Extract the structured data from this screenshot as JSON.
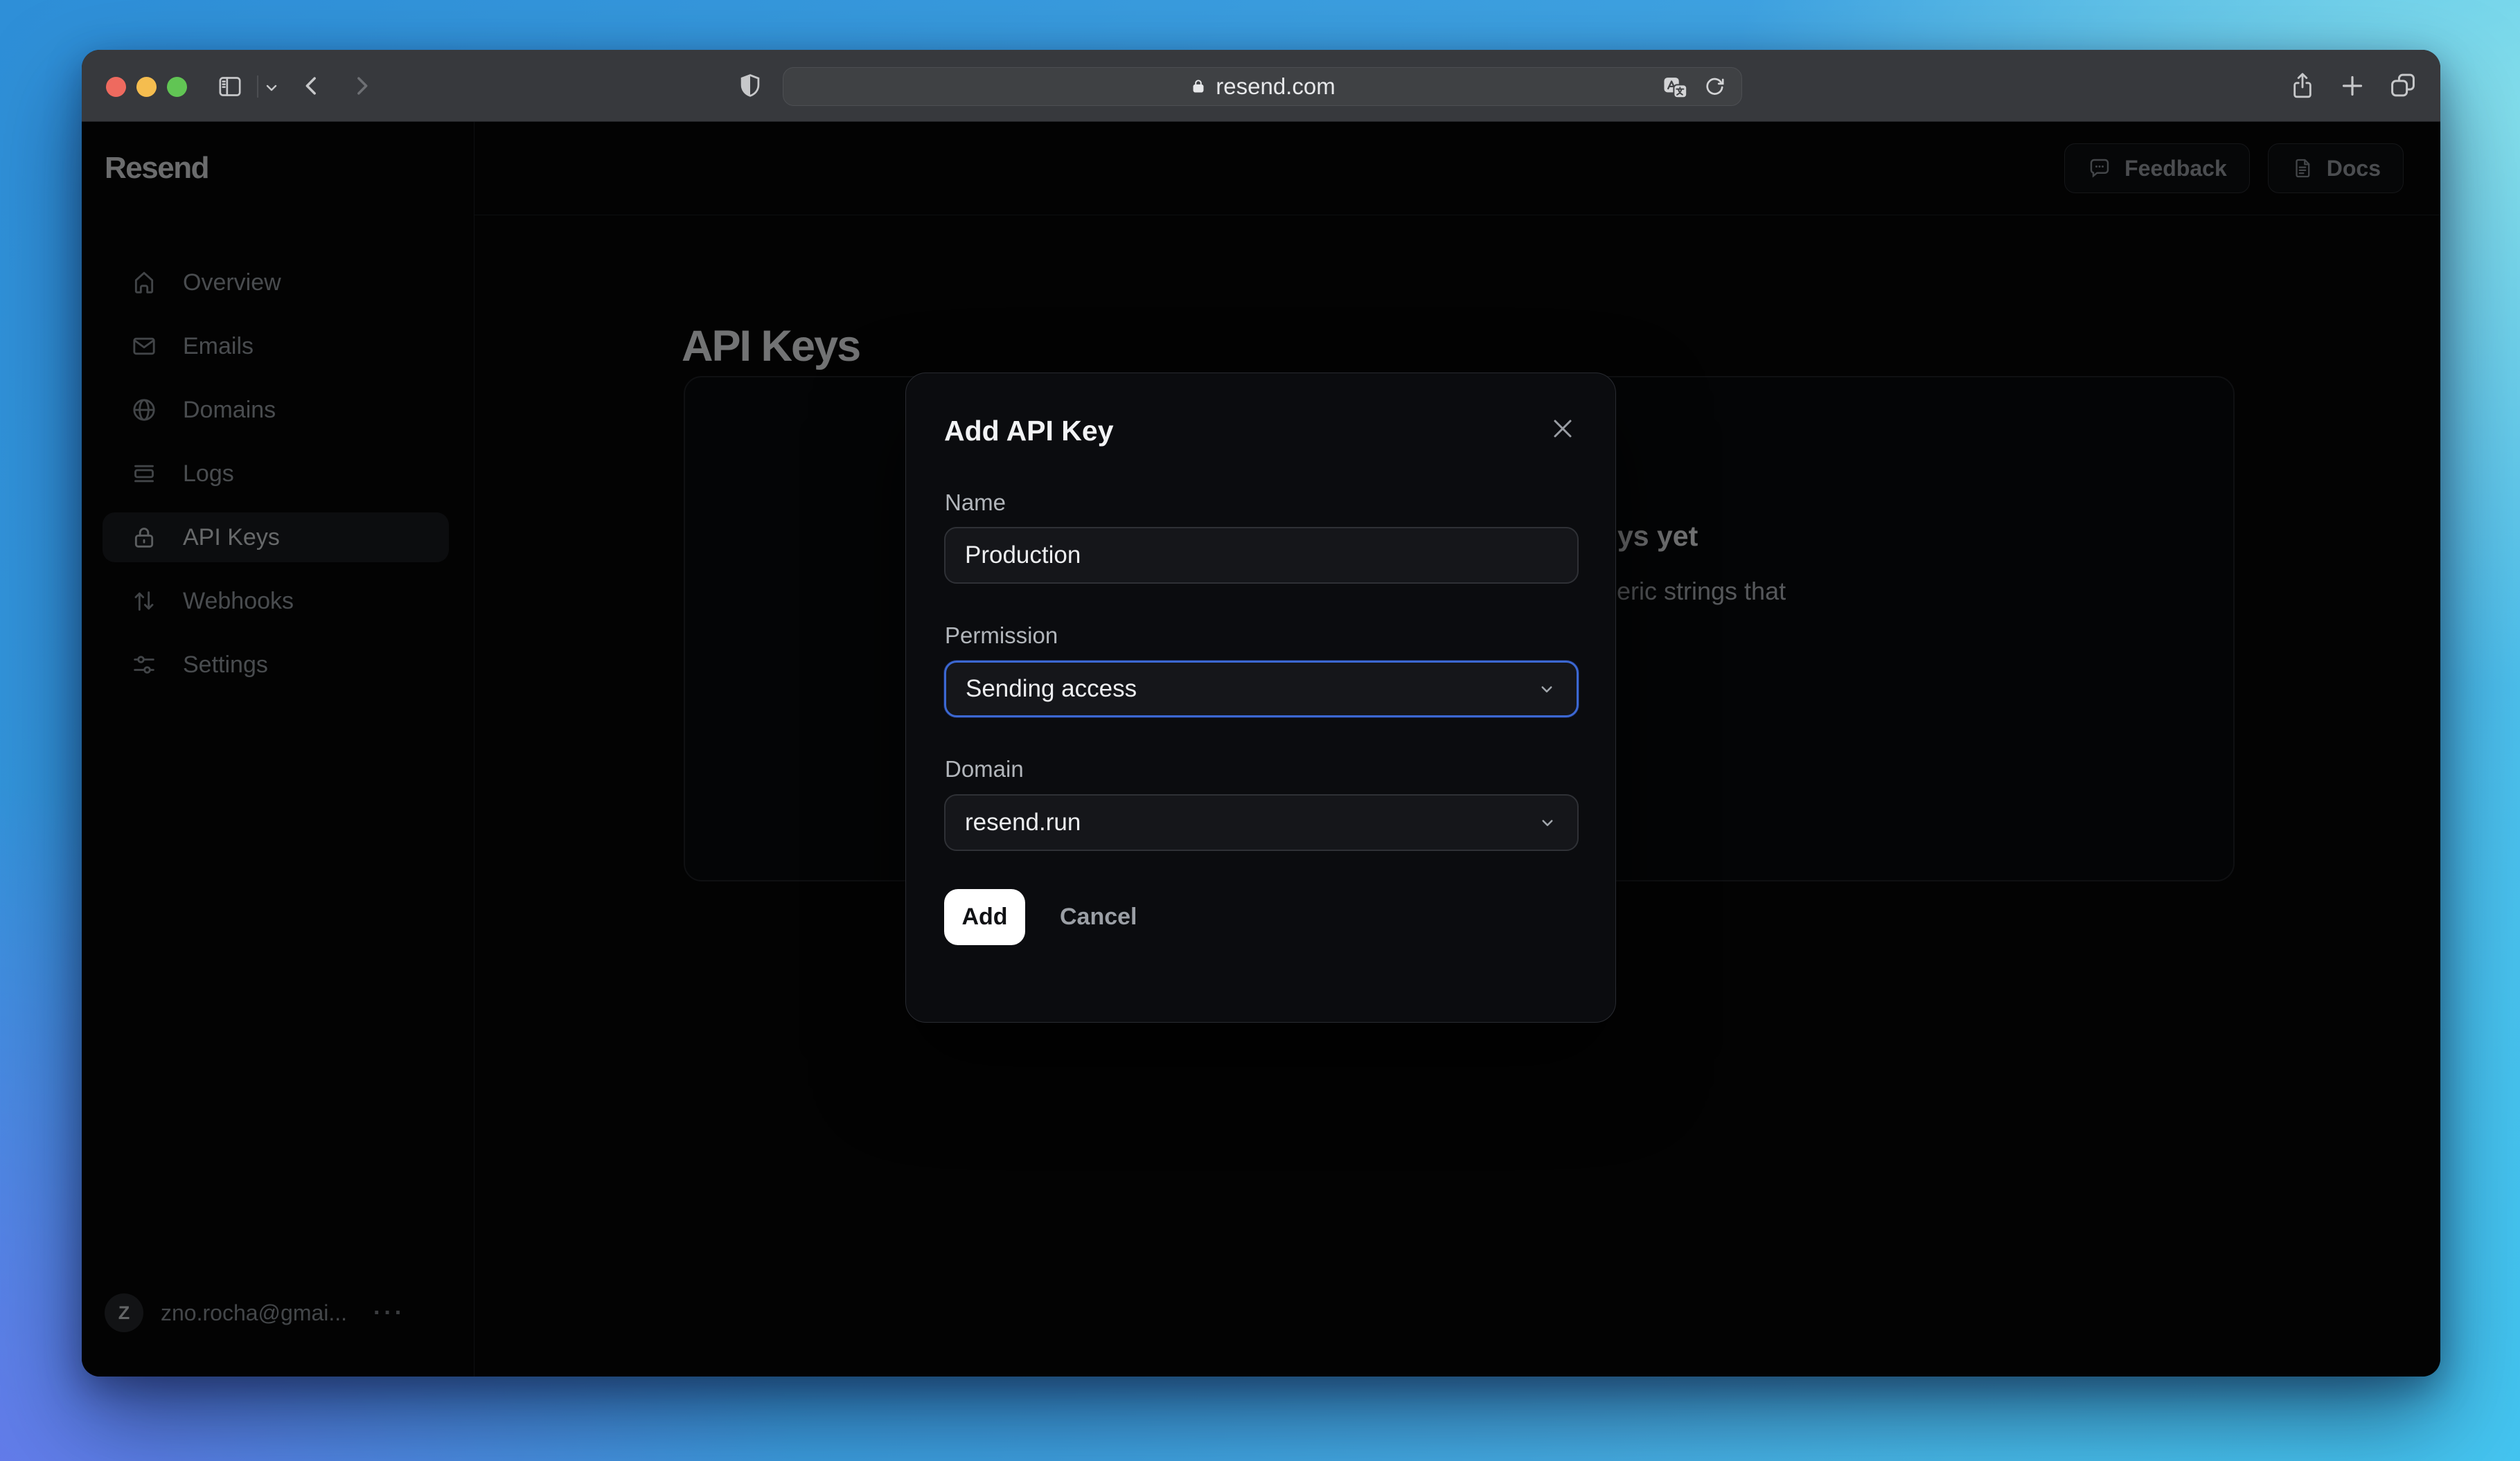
{
  "browser": {
    "url": "resend.com",
    "traffic_lights": [
      "close",
      "minimize",
      "zoom"
    ],
    "toolbar_icons": [
      "sidebar-toggle",
      "chevron-down",
      "back",
      "forward",
      "shield",
      "lock",
      "translate",
      "reload",
      "share",
      "new-tab",
      "tab-overview"
    ]
  },
  "sidebar": {
    "logo": "Resend",
    "items": [
      {
        "label": "Overview",
        "icon": "home-icon",
        "active": false
      },
      {
        "label": "Emails",
        "icon": "envelope-icon",
        "active": false
      },
      {
        "label": "Domains",
        "icon": "globe-icon",
        "active": false
      },
      {
        "label": "Logs",
        "icon": "logs-icon",
        "active": false
      },
      {
        "label": "API Keys",
        "icon": "lock-icon",
        "active": true
      },
      {
        "label": "Webhooks",
        "icon": "arrows-icon",
        "active": false
      },
      {
        "label": "Settings",
        "icon": "sliders-icon",
        "active": false
      }
    ],
    "user": {
      "initial": "Z",
      "email": "zno.rocha@gmai...",
      "menu": "···"
    }
  },
  "header": {
    "buttons": [
      {
        "label": "Feedback",
        "icon": "speech-bubble-icon"
      },
      {
        "label": "Docs",
        "icon": "document-icon"
      }
    ]
  },
  "main": {
    "title": "API Keys",
    "empty_state": {
      "heading_visible_fragment": "ys yet",
      "body_visible_fragment": "eric strings that"
    }
  },
  "modal": {
    "title": "Add API Key",
    "name_label": "Name",
    "name_value": "Production",
    "permission_label": "Permission",
    "permission_value": "Sending access",
    "domain_label": "Domain",
    "domain_value": "resend.run",
    "add_label": "Add",
    "cancel_label": "Cancel"
  },
  "colors": {
    "traffic_red": "#ee6a5f",
    "traffic_yellow": "#f5bd4f",
    "traffic_green": "#61c554",
    "focus_ring": "#3c68d2",
    "add_button_bg": "#ffffff",
    "background_gradient": [
      "#2e8fd8",
      "#7173ee",
      "#3fc3f0",
      "#88e2ec"
    ]
  }
}
